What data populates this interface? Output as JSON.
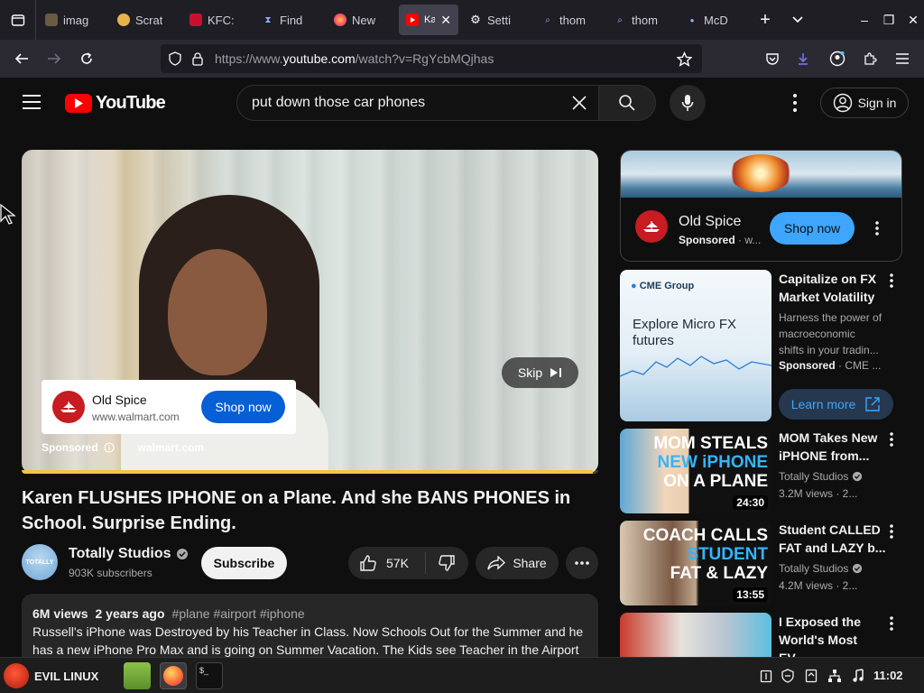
{
  "browser": {
    "tabs": [
      {
        "title": "imag",
        "active": false
      },
      {
        "title": "Scrat",
        "active": false
      },
      {
        "title": "KFC:",
        "active": false
      },
      {
        "title": "Find",
        "active": false
      },
      {
        "title": "New",
        "active": false
      },
      {
        "title": "Ka PL",
        "active": true
      },
      {
        "title": "Setti",
        "active": false
      },
      {
        "title": "thom",
        "active": false
      },
      {
        "title": "thom",
        "active": false
      },
      {
        "title": "McD",
        "active": false
      }
    ],
    "url_prefix": "https://www.",
    "url_host": "youtube.com",
    "url_path": "/watch?v=RgYcbMQjhas"
  },
  "youtube": {
    "logo_text": "YouTube",
    "search_query": "put down those car phones",
    "signin_label": "Sign in"
  },
  "player": {
    "skip_label": "Skip",
    "ad_name": "Old Spice",
    "ad_domain": "www.walmart.com",
    "ad_cta": "Shop now",
    "sponsored_label": "Sponsored",
    "sponsored_domain": "walmart.com",
    "ad_progress": 0.99
  },
  "video": {
    "title": "Karen FLUSHES IPHONE on a Plane. And she BANS PHONES in School. Surprise Ending.",
    "channel": "Totally Studios",
    "avatar_text": "TOTALLY",
    "subscribers": "903K subscribers",
    "subscribe_label": "Subscribe",
    "likes": "57K",
    "share_label": "Share",
    "views": "6M views",
    "age": "2 years ago",
    "hashtags": "#plane #airport #iphone",
    "description": "Russell's iPhone was Destroyed by his Teacher in Class. Now Schools Out for the Summer and he has a new iPhone Pro Max and is going on Summer Vacation. The Kids see Teacher in the Airport"
  },
  "sidebar": {
    "ad": {
      "name": "Old Spice",
      "sponsored": "Sponsored",
      "domain": "· w...",
      "cta": "Shop now"
    },
    "cme": {
      "brand": "CME Group",
      "headline": "Explore Micro FX futures",
      "title": "Capitalize on FX Market Volatility",
      "body": "Harness the power of macroeconomic shifts in your tradin...",
      "sponsored": "Sponsored",
      "advertiser": "· CME ...",
      "cta": "Learn more"
    },
    "recs": [
      {
        "title": "MOM Takes New iPHONE from...",
        "channel": "Totally Studios",
        "meta": "3.2M views · 2...",
        "duration": "24:30",
        "thumb_lines": [
          "MOM STEALS",
          "NEW iPHONE",
          "ON A PLANE"
        ]
      },
      {
        "title": "Student CALLED FAT and LAZY b...",
        "channel": "Totally Studios",
        "meta": "4.2M views · 2...",
        "duration": "13:55",
        "thumb_lines": [
          "COACH CALLS",
          "STUDENT",
          "FAT & LAZY"
        ]
      },
      {
        "title": "I Exposed the World's Most EV...",
        "channel": "",
        "meta": "",
        "duration": "",
        "thumb_lines": []
      }
    ]
  },
  "taskbar": {
    "start_label": "EVIL LINUX",
    "clock": "11:02"
  },
  "colors": {
    "yt_red": "#ff0000",
    "shop_blue": "#065fd4",
    "sidebar_shop": "#3ea6ff",
    "progress": "#f6c244"
  }
}
